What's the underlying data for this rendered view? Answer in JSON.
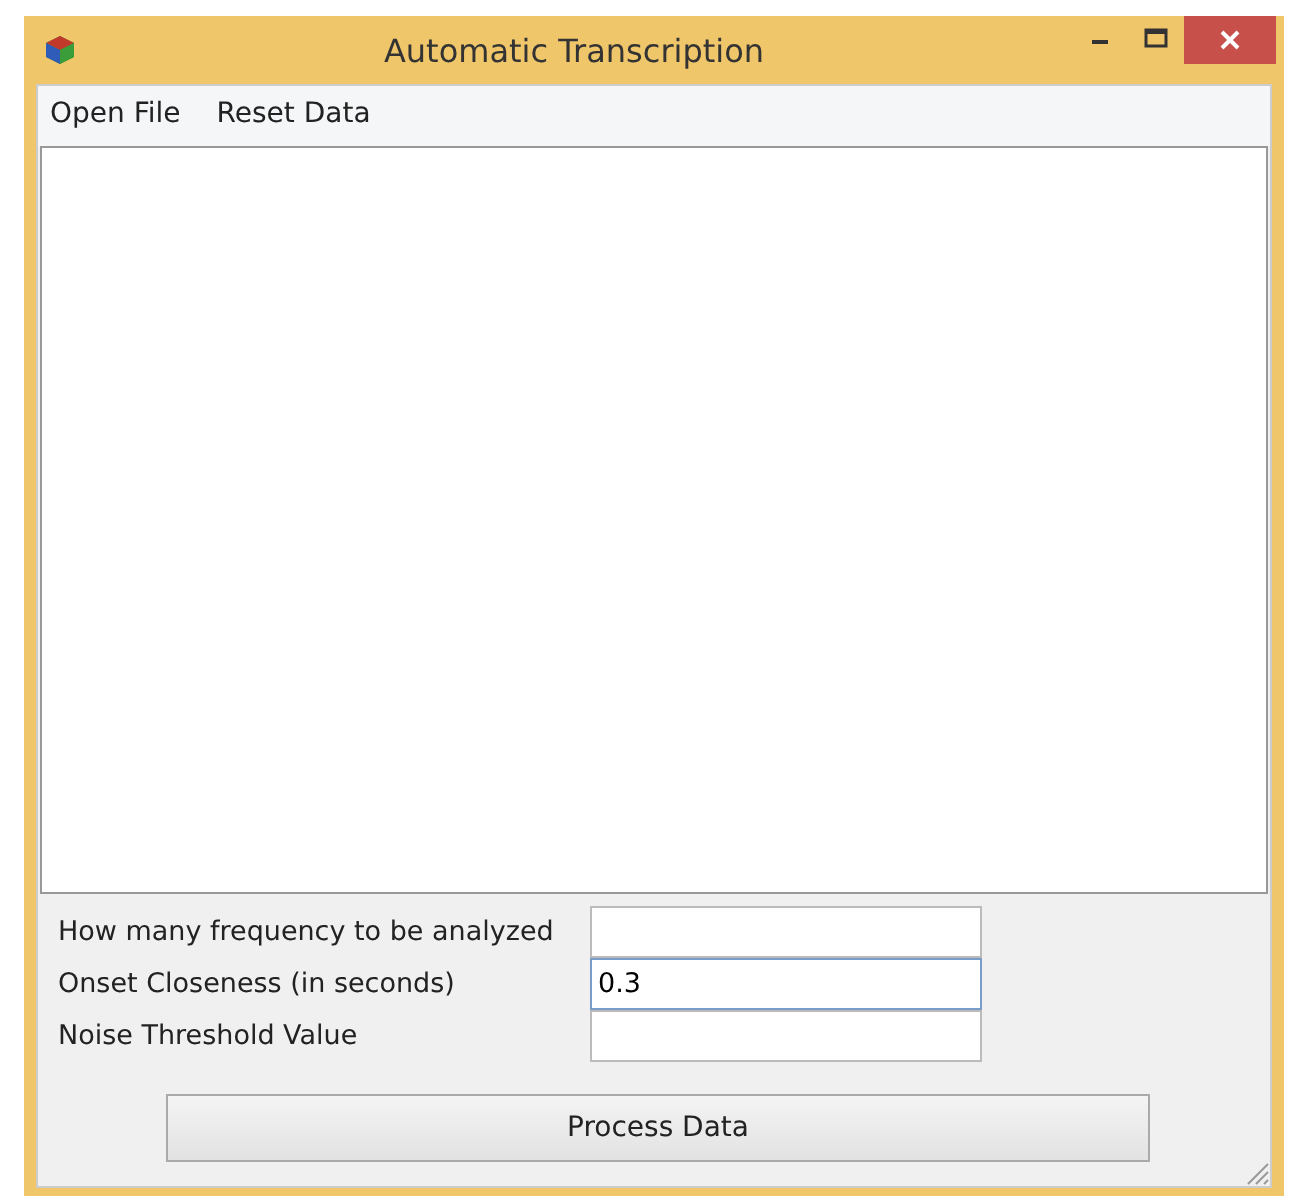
{
  "window": {
    "title": "Automatic Transcription"
  },
  "menu": [
    "Open File",
    "Reset Data"
  ],
  "fields": [
    {
      "label": "How many frequency to be analyzed",
      "focused": false
    },
    {
      "label": "Onset Closeness (in seconds)",
      "value": "0.3",
      "focused": true
    },
    {
      "label": "Noise Threshold Value",
      "focused": false
    }
  ],
  "buttons": [
    "Process Data"
  ]
}
